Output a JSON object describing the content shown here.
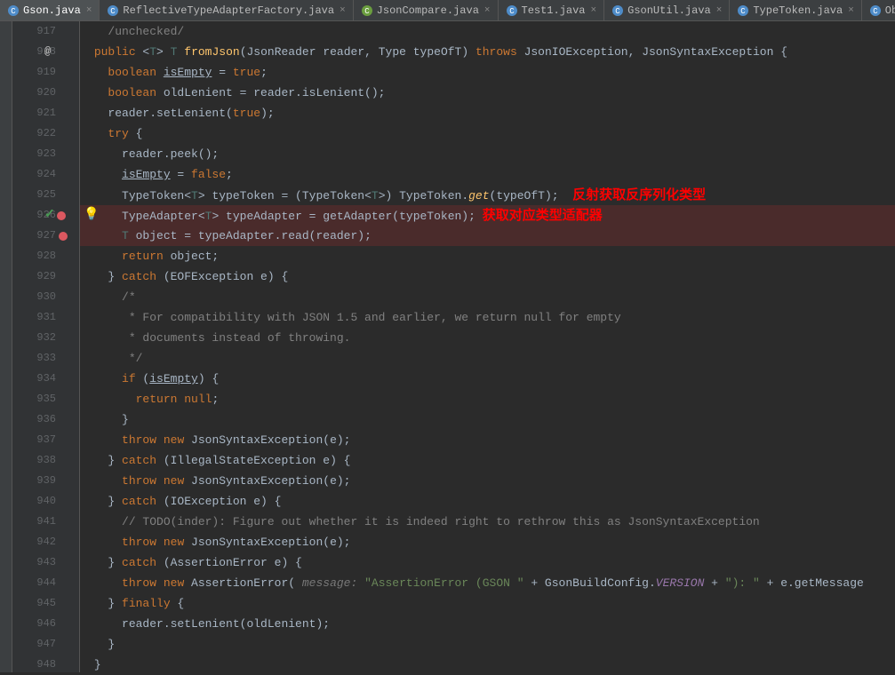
{
  "tabs": [
    {
      "label": "Gson.java",
      "active": true,
      "iconType": "class"
    },
    {
      "label": "ReflectiveTypeAdapterFactory.java",
      "active": false,
      "iconType": "class"
    },
    {
      "label": "JsonCompare.java",
      "active": false,
      "iconType": "clazz"
    },
    {
      "label": "Test1.java",
      "active": false,
      "iconType": "clazz"
    },
    {
      "label": "GsonUtil.java",
      "active": false,
      "iconType": "clazz"
    },
    {
      "label": "TypeToken.java",
      "active": false,
      "iconType": "class"
    },
    {
      "label": "ObjTypeAdapte",
      "active": false,
      "iconType": "class"
    }
  ],
  "gutter": {
    "lines": [
      "917",
      "918",
      "919",
      "920",
      "921",
      "922",
      "923",
      "924",
      "925",
      "926",
      "927",
      "928",
      "929",
      "930",
      "931",
      "932",
      "933",
      "934",
      "935",
      "936",
      "937",
      "938",
      "939",
      "940",
      "941",
      "942",
      "943",
      "944",
      "945",
      "946",
      "947",
      "948"
    ],
    "annotation_line": 1,
    "at_symbol": "@",
    "breakpoint_check_line": 9,
    "breakpoint_only_line": 10,
    "check_symbol": "✓",
    "bulb_line": 9
  },
  "annotations": {
    "line925": "反射获取反序列化类型",
    "line926": "获取对应类型适配器"
  },
  "code": {
    "l917": "/unchecked/",
    "l918_public": "public",
    "l918_fromJson": "fromJson",
    "l918_reader": "(JsonReader reader, Type typeOfT) ",
    "l918_throws": "throws",
    "l918_exc": " JsonIOException, JsonSyntaxException {",
    "l919_boolean": "boolean",
    "l919_isEmpty": "isEmpty",
    "l919_rest": " = ",
    "l919_true": "true",
    "l919_semi": ";",
    "l920_boolean": "boolean",
    "l920_rest": " oldLenient = reader.isLenient();",
    "l921_reader": "reader.setLenient(",
    "l921_true": "true",
    "l921_end": ");",
    "l922_try": "try",
    "l922_brace": " {",
    "l923": "reader.peek();",
    "l924_isEmpty": "isEmpty",
    "l924_rest": " = ",
    "l924_false": "false",
    "l924_semi": ";",
    "l925_a": "TypeToken<",
    "l925_t": "T",
    "l925_b": "> typeToken = (TypeToken<",
    "l925_c": ">) TypeToken.",
    "l925_get": "get",
    "l925_d": "(typeOfT);",
    "l926_a": "TypeAdapter<",
    "l926_t": "T",
    "l926_b": "> typeAdapter = getAdapter(typeToken);",
    "l927_a": "T",
    "l927_b": " object = typeAdapter.read(reader);",
    "l928_return": "return",
    "l928_obj": " object;",
    "l929_a": "} ",
    "l929_catch": "catch",
    "l929_b": " (EOFException e) {",
    "l930": "/*",
    "l931": " * For compatibility with JSON 1.5 and earlier, we return null for empty",
    "l932": " * documents instead of throwing.",
    "l933": " */",
    "l934_if": "if",
    "l934_a": " (",
    "l934_isEmpty": "isEmpty",
    "l934_b": ") {",
    "l935_return": "return",
    "l935_null": "null",
    "l935_semi": ";",
    "l936": "}",
    "l937_throw": "throw",
    "l937_new": "new",
    "l937_a": " JsonSyntaxException(e);",
    "l938_a": "} ",
    "l938_catch": "catch",
    "l938_b": " (IllegalStateException e) {",
    "l939_throw": "throw",
    "l939_new": "new",
    "l939_a": " JsonSyntaxException(e);",
    "l940_a": "} ",
    "l940_catch": "catch",
    "l940_b": " (IOException e) {",
    "l941": "// TODO(inder): Figure out whether it is indeed right to rethrow this as JsonSyntaxException",
    "l942_throw": "throw",
    "l942_new": "new",
    "l942_a": " JsonSyntaxException(e);",
    "l943_a": "} ",
    "l943_catch": "catch",
    "l943_b": " (AssertionError e) {",
    "l944_throw": "throw",
    "l944_new": "new",
    "l944_a": " AssertionError(",
    "l944_hint": " message: ",
    "l944_str1": "\"AssertionError (GSON \"",
    "l944_plus1": " + GsonBuildConfig.",
    "l944_version": "VERSION",
    "l944_plus2": " + ",
    "l944_str2": "\"): \"",
    "l944_plus3": " + e.getMessage",
    "l945_a": "} ",
    "l945_finally": "finally",
    "l945_b": " {",
    "l946": "reader.setLenient(oldLenient);",
    "l947": "}",
    "l948": "}"
  }
}
